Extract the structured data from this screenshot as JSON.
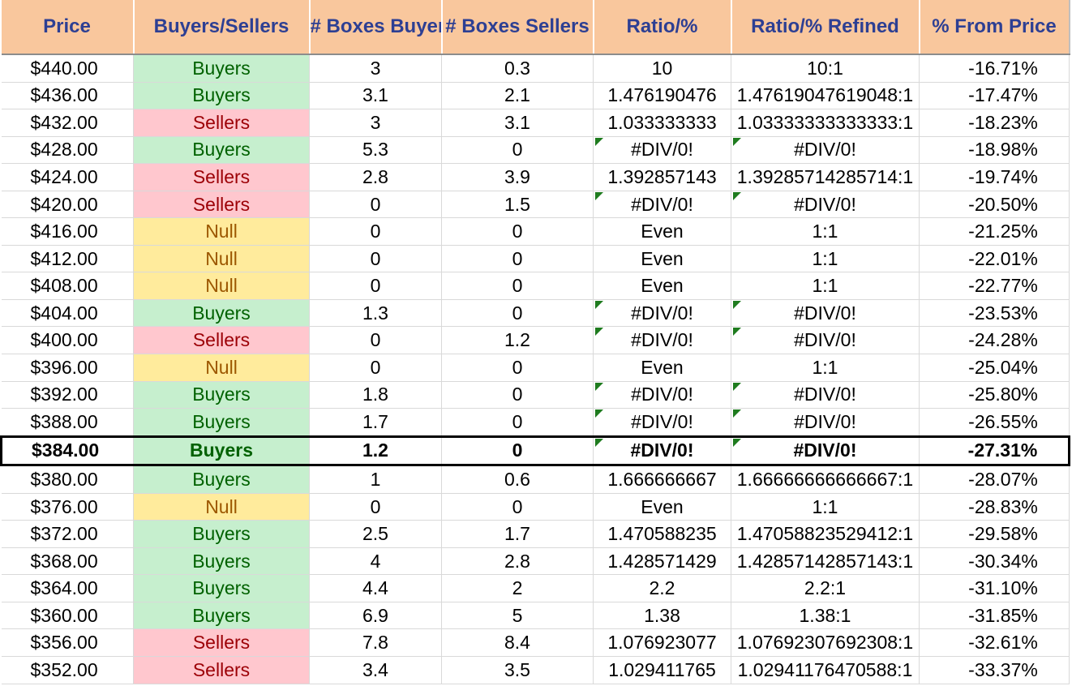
{
  "colors": {
    "header_bg": "#f9c79d",
    "header_text": "#2d3f93",
    "buyers_bg": "#c6efce",
    "buyers_text": "#006100",
    "sellers_bg": "#ffc7ce",
    "sellers_text": "#9c0006",
    "null_bg": "#ffeb9c",
    "null_text": "#9c5700"
  },
  "headers": [
    "Price",
    "Buyers/Sellers",
    "# Boxes Buyers",
    "# Boxes Sellers",
    "Ratio/%",
    "Ratio/% Refined",
    "% From Price"
  ],
  "highlight_row": 14,
  "rows": [
    {
      "price": "$440.00",
      "side": "Buyers",
      "bb": "3",
      "bs": "0.3",
      "ratio": "10",
      "refined": "10:1",
      "pct": "-16.71%"
    },
    {
      "price": "$436.00",
      "side": "Buyers",
      "bb": "3.1",
      "bs": "2.1",
      "ratio": "1.476190476",
      "refined": "1.47619047619048:1",
      "pct": "-17.47%"
    },
    {
      "price": "$432.00",
      "side": "Sellers",
      "bb": "3",
      "bs": "3.1",
      "ratio": "1.033333333",
      "refined": "1.03333333333333:1",
      "pct": "-18.23%"
    },
    {
      "price": "$428.00",
      "side": "Buyers",
      "bb": "5.3",
      "bs": "0",
      "ratio": "#DIV/0!",
      "refined": "#DIV/0!",
      "pct": "-18.98%"
    },
    {
      "price": "$424.00",
      "side": "Sellers",
      "bb": "2.8",
      "bs": "3.9",
      "ratio": "1.392857143",
      "refined": "1.39285714285714:1",
      "pct": "-19.74%"
    },
    {
      "price": "$420.00",
      "side": "Sellers",
      "bb": "0",
      "bs": "1.5",
      "ratio": "#DIV/0!",
      "refined": "#DIV/0!",
      "pct": "-20.50%"
    },
    {
      "price": "$416.00",
      "side": "Null",
      "bb": "0",
      "bs": "0",
      "ratio": "Even",
      "refined": "1:1",
      "pct": "-21.25%"
    },
    {
      "price": "$412.00",
      "side": "Null",
      "bb": "0",
      "bs": "0",
      "ratio": "Even",
      "refined": "1:1",
      "pct": "-22.01%"
    },
    {
      "price": "$408.00",
      "side": "Null",
      "bb": "0",
      "bs": "0",
      "ratio": "Even",
      "refined": "1:1",
      "pct": "-22.77%"
    },
    {
      "price": "$404.00",
      "side": "Buyers",
      "bb": "1.3",
      "bs": "0",
      "ratio": "#DIV/0!",
      "refined": "#DIV/0!",
      "pct": "-23.53%"
    },
    {
      "price": "$400.00",
      "side": "Sellers",
      "bb": "0",
      "bs": "1.2",
      "ratio": "#DIV/0!",
      "refined": "#DIV/0!",
      "pct": "-24.28%"
    },
    {
      "price": "$396.00",
      "side": "Null",
      "bb": "0",
      "bs": "0",
      "ratio": "Even",
      "refined": "1:1",
      "pct": "-25.04%"
    },
    {
      "price": "$392.00",
      "side": "Buyers",
      "bb": "1.8",
      "bs": "0",
      "ratio": "#DIV/0!",
      "refined": "#DIV/0!",
      "pct": "-25.80%"
    },
    {
      "price": "$388.00",
      "side": "Buyers",
      "bb": "1.7",
      "bs": "0",
      "ratio": "#DIV/0!",
      "refined": "#DIV/0!",
      "pct": "-26.55%"
    },
    {
      "price": "$384.00",
      "side": "Buyers",
      "bb": "1.2",
      "bs": "0",
      "ratio": "#DIV/0!",
      "refined": "#DIV/0!",
      "pct": "-27.31%"
    },
    {
      "price": "$380.00",
      "side": "Buyers",
      "bb": "1",
      "bs": "0.6",
      "ratio": "1.666666667",
      "refined": "1.66666666666667:1",
      "pct": "-28.07%"
    },
    {
      "price": "$376.00",
      "side": "Null",
      "bb": "0",
      "bs": "0",
      "ratio": "Even",
      "refined": "1:1",
      "pct": "-28.83%"
    },
    {
      "price": "$372.00",
      "side": "Buyers",
      "bb": "2.5",
      "bs": "1.7",
      "ratio": "1.470588235",
      "refined": "1.47058823529412:1",
      "pct": "-29.58%"
    },
    {
      "price": "$368.00",
      "side": "Buyers",
      "bb": "4",
      "bs": "2.8",
      "ratio": "1.428571429",
      "refined": "1.42857142857143:1",
      "pct": "-30.34%"
    },
    {
      "price": "$364.00",
      "side": "Buyers",
      "bb": "4.4",
      "bs": "2",
      "ratio": "2.2",
      "refined": "2.2:1",
      "pct": "-31.10%"
    },
    {
      "price": "$360.00",
      "side": "Buyers",
      "bb": "6.9",
      "bs": "5",
      "ratio": "1.38",
      "refined": "1.38:1",
      "pct": "-31.85%"
    },
    {
      "price": "$356.00",
      "side": "Sellers",
      "bb": "7.8",
      "bs": "8.4",
      "ratio": "1.076923077",
      "refined": "1.07692307692308:1",
      "pct": "-32.61%"
    },
    {
      "price": "$352.00",
      "side": "Sellers",
      "bb": "3.4",
      "bs": "3.5",
      "ratio": "1.029411765",
      "refined": "1.02941176470588:1",
      "pct": "-33.37%"
    }
  ]
}
